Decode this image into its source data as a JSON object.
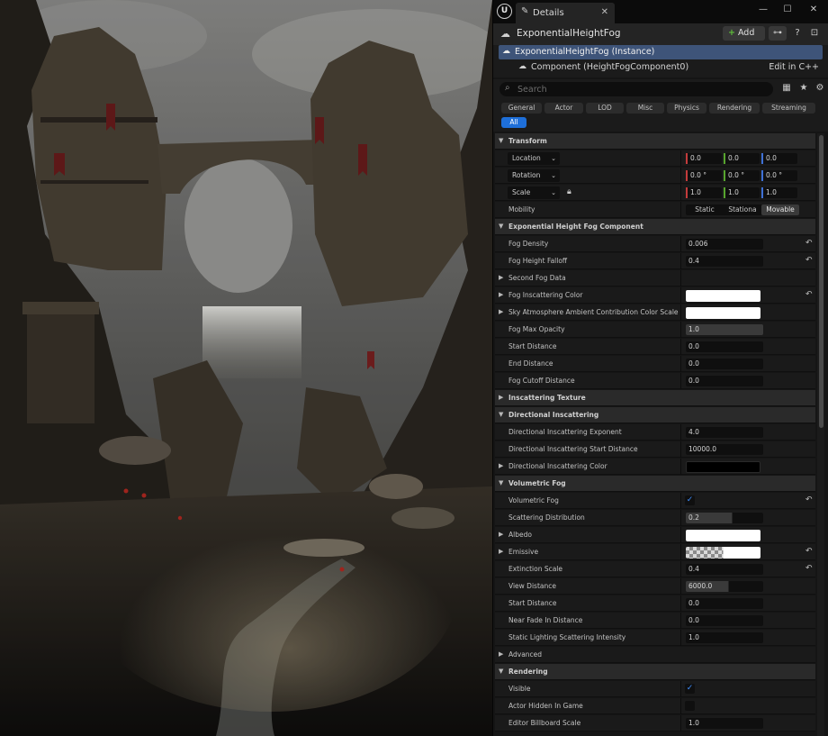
{
  "tab": {
    "title": "Details"
  },
  "actor": {
    "title": "ExponentialHeightFog",
    "add_label": "Add"
  },
  "components": {
    "root": "ExponentialHeightFog (Instance)",
    "child": "Component (HeightFogComponent0)",
    "edit_link": "Edit in C++"
  },
  "search": {
    "placeholder": "Search"
  },
  "filters": [
    {
      "label": "General",
      "active": false
    },
    {
      "label": "Actor",
      "active": false
    },
    {
      "label": "LOD",
      "active": false
    },
    {
      "label": "Misc",
      "active": false
    },
    {
      "label": "Physics",
      "active": false
    },
    {
      "label": "Rendering",
      "active": false
    },
    {
      "label": "Streaming",
      "active": false
    },
    {
      "label": "All",
      "active": true
    }
  ],
  "transform": {
    "category": "Transform",
    "location": {
      "label": "Location",
      "x": "0.0",
      "y": "0.0",
      "z": "0.0"
    },
    "rotation": {
      "label": "Rotation",
      "x": "0.0 °",
      "y": "0.0 °",
      "z": "0.0 °"
    },
    "scale": {
      "label": "Scale",
      "x": "1.0",
      "y": "1.0",
      "z": "1.0"
    },
    "mobility": {
      "label": "Mobility",
      "options": [
        "Static",
        "Stationa",
        "Movable"
      ],
      "selected": "Movable"
    }
  },
  "fog_component": {
    "category": "Exponential Height Fog Component",
    "fog_density": {
      "label": "Fog Density",
      "value": "0.006"
    },
    "fog_height_falloff": {
      "label": "Fog Height Falloff",
      "value": "0.4"
    },
    "second_fog_data": {
      "label": "Second Fog Data"
    },
    "fog_inscattering_color": {
      "label": "Fog Inscattering Color",
      "color": "#ffffff"
    },
    "sky_atmosphere": {
      "label": "Sky Atmosphere Ambient Contribution Color Scale",
      "color": "#ffffff"
    },
    "fog_max_opacity": {
      "label": "Fog Max Opacity",
      "value": "1.0",
      "fill": 1.0
    },
    "start_distance": {
      "label": "Start Distance",
      "value": "0.0"
    },
    "end_distance": {
      "label": "End Distance",
      "value": "0.0"
    },
    "fog_cutoff_distance": {
      "label": "Fog Cutoff Distance",
      "value": "0.0"
    }
  },
  "inscattering_texture": {
    "category": "Inscattering Texture"
  },
  "directional": {
    "category": "Directional Inscattering",
    "exponent": {
      "label": "Directional Inscattering Exponent",
      "value": "4.0"
    },
    "start_distance": {
      "label": "Directional Inscattering Start Distance",
      "value": "10000.0"
    },
    "color": {
      "label": "Directional Inscattering Color",
      "color": "#000000"
    }
  },
  "volumetric": {
    "category": "Volumetric Fog",
    "volumetric_fog": {
      "label": "Volumetric Fog",
      "checked": true
    },
    "scattering_distribution": {
      "label": "Scattering Distribution",
      "value": "0.2",
      "fill": 0.6
    },
    "albedo": {
      "label": "Albedo",
      "color": "#ffffff"
    },
    "emissive": {
      "label": "Emissive"
    },
    "extinction_scale": {
      "label": "Extinction Scale",
      "value": "0.4"
    },
    "view_distance": {
      "label": "View Distance",
      "value": "6000.0",
      "fill": 0.55
    },
    "start_distance": {
      "label": "Start Distance",
      "value": "0.0"
    },
    "near_fade_in_distance": {
      "label": "Near Fade In Distance",
      "value": "0.0"
    },
    "static_lighting": {
      "label": "Static Lighting Scattering Intensity",
      "value": "1.0"
    }
  },
  "advanced": {
    "category": "Advanced"
  },
  "rendering": {
    "category": "Rendering",
    "visible": {
      "label": "Visible",
      "checked": true
    },
    "actor_hidden": {
      "label": "Actor Hidden In Game",
      "checked": false
    },
    "billboard_scale": {
      "label": "Editor Billboard Scale",
      "value": "1.0"
    }
  }
}
